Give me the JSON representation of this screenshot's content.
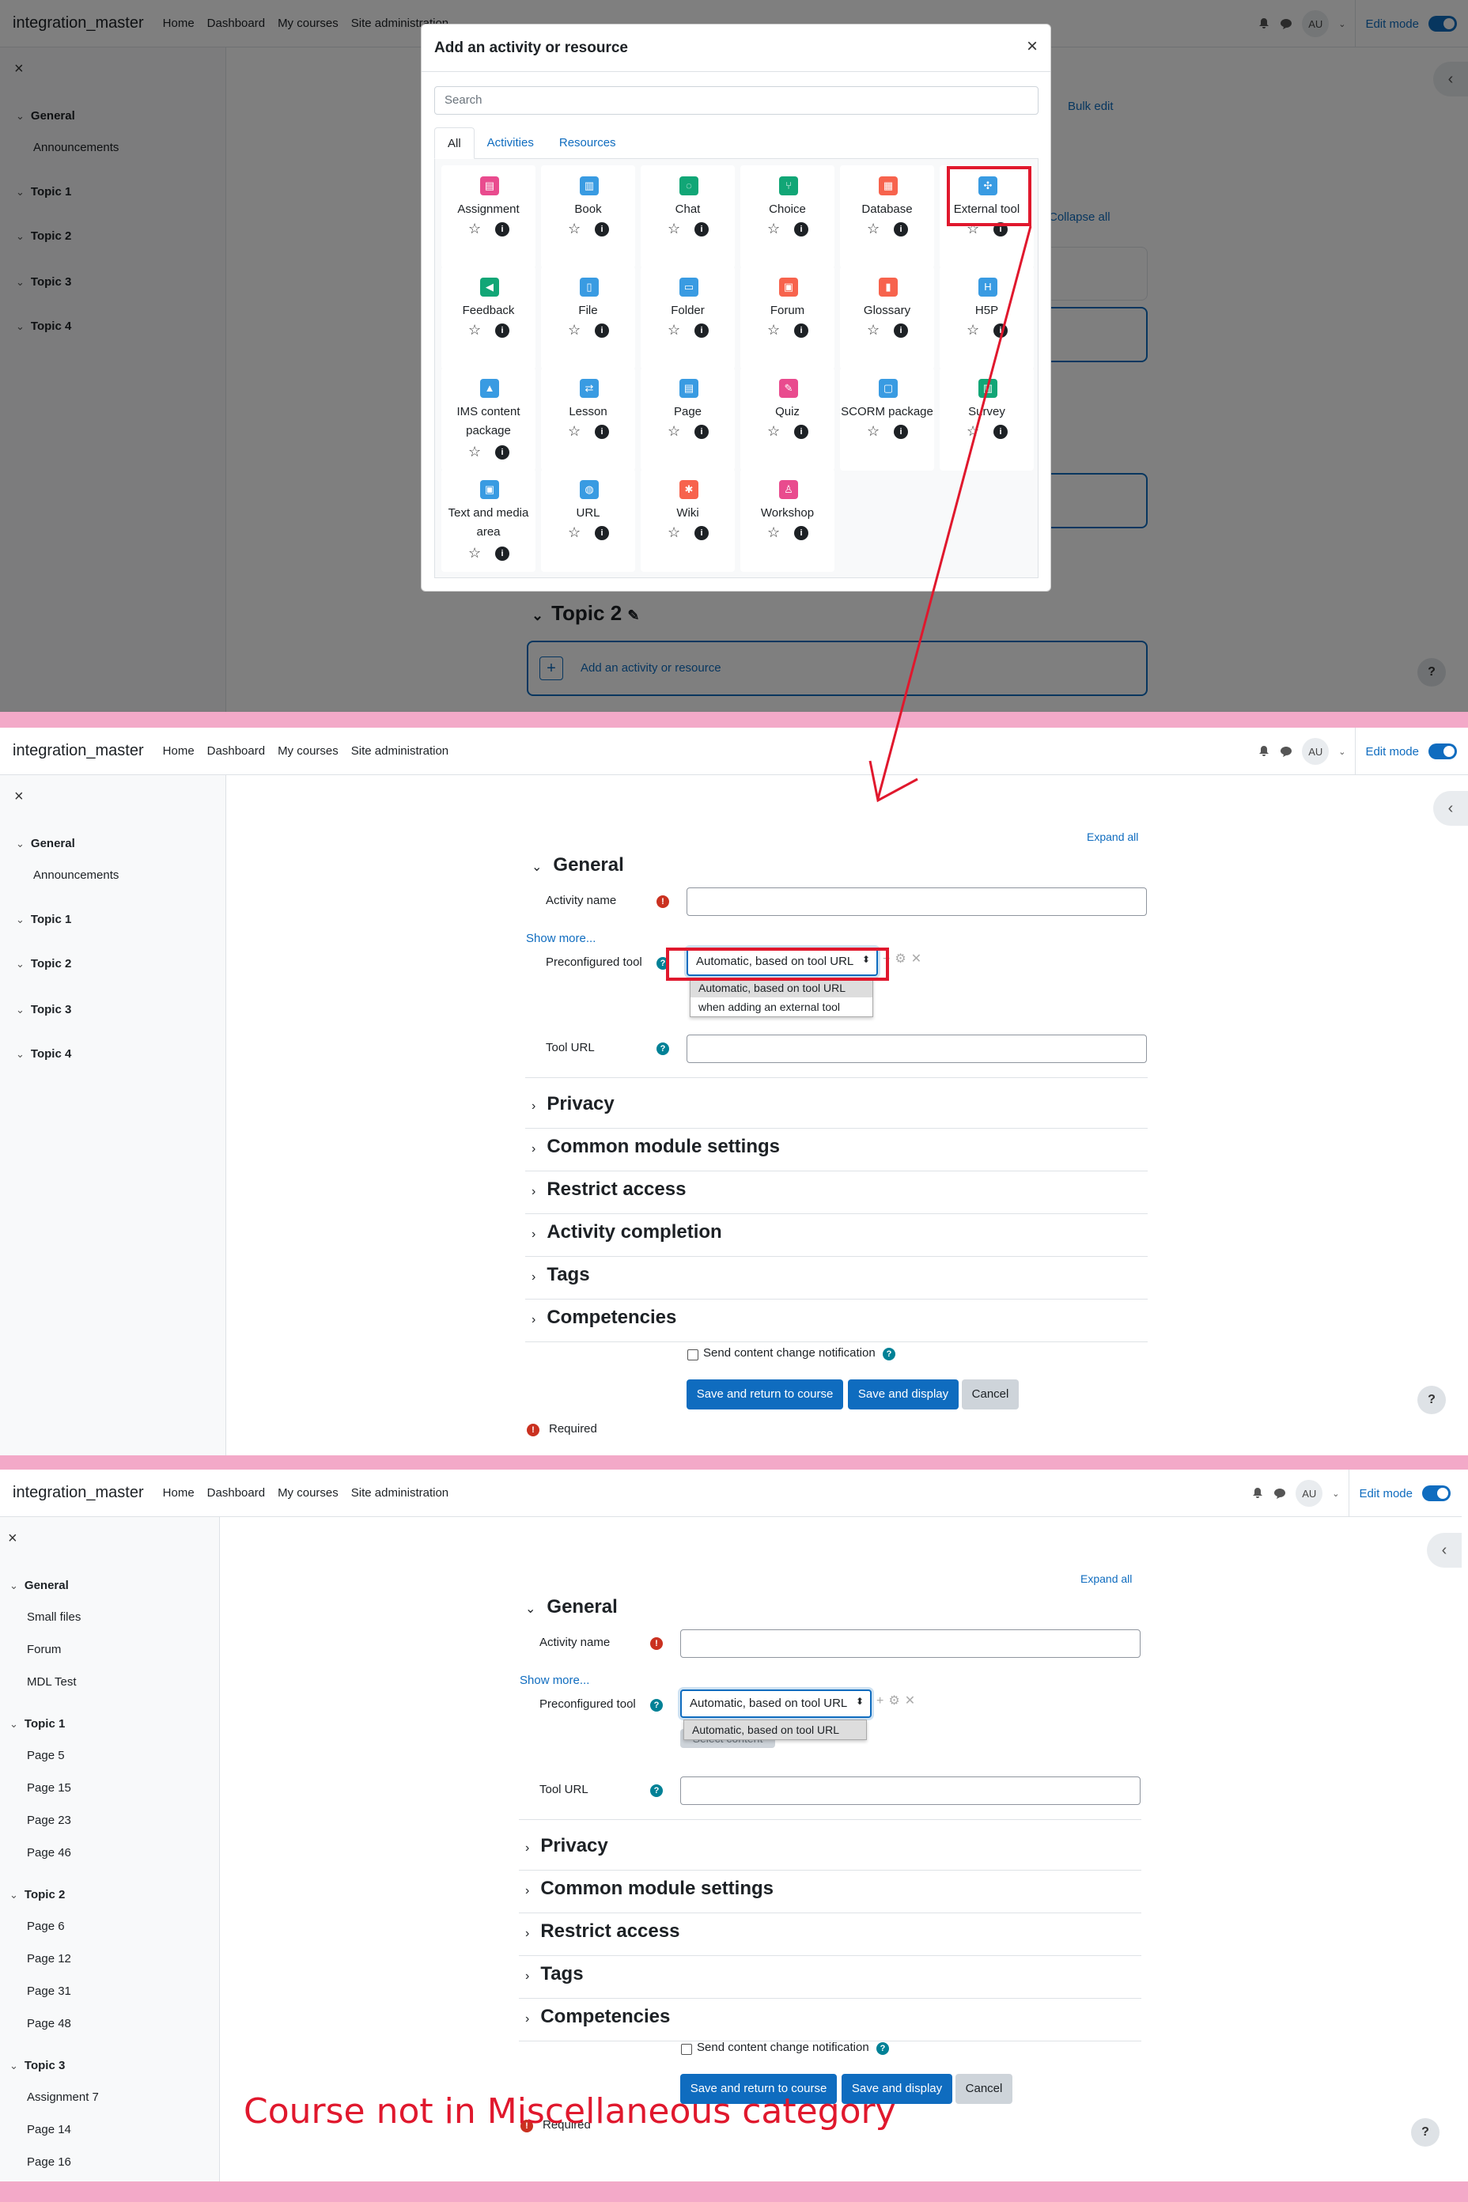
{
  "nav": {
    "brand": "integration_master",
    "links": [
      "Home",
      "Dashboard",
      "My courses",
      "Site administration"
    ],
    "avatar": "AU",
    "edit_mode": "Edit mode"
  },
  "panel1": {
    "drawer": {
      "close": "×",
      "sections": [
        {
          "title": "General",
          "items": [
            "Announcements"
          ]
        },
        {
          "title": "Topic 1",
          "items": []
        },
        {
          "title": "Topic 2",
          "items": []
        },
        {
          "title": "Topic 3",
          "items": []
        },
        {
          "title": "Topic 4",
          "items": []
        }
      ]
    },
    "background": {
      "bulk_edit": "Bulk edit",
      "collapse_all": "Collapse all",
      "topic2_heading": "Topic 2",
      "add_activity": "Add an activity or resource"
    },
    "modal": {
      "title": "Add an activity or resource",
      "close": "×",
      "search_placeholder": "Search",
      "tabs": [
        "All",
        "Activities",
        "Resources"
      ],
      "tiles": [
        {
          "name": "Assignment",
          "color": "#e94b8e",
          "glyph": "▤"
        },
        {
          "name": "Book",
          "color": "#399be2",
          "glyph": "▥"
        },
        {
          "name": "Chat",
          "color": "#11a676",
          "glyph": "◌"
        },
        {
          "name": "Choice",
          "color": "#11a676",
          "glyph": "⑂"
        },
        {
          "name": "Database",
          "color": "#f7634d",
          "glyph": "▦"
        },
        {
          "name": "External tool",
          "color": "#399be2",
          "glyph": "✣"
        },
        {
          "name": "Feedback",
          "color": "#11a676",
          "glyph": "◀"
        },
        {
          "name": "File",
          "color": "#399be2",
          "glyph": "▯"
        },
        {
          "name": "Folder",
          "color": "#399be2",
          "glyph": "▭"
        },
        {
          "name": "Forum",
          "color": "#f7634d",
          "glyph": "▣"
        },
        {
          "name": "Glossary",
          "color": "#f7634d",
          "glyph": "▮"
        },
        {
          "name": "H5P",
          "color": "#399be2",
          "glyph": "H"
        },
        {
          "name": "IMS content package",
          "color": "#399be2",
          "glyph": "▲"
        },
        {
          "name": "Lesson",
          "color": "#399be2",
          "glyph": "⇄"
        },
        {
          "name": "Page",
          "color": "#399be2",
          "glyph": "▤"
        },
        {
          "name": "Quiz",
          "color": "#e94b8e",
          "glyph": "✎"
        },
        {
          "name": "SCORM package",
          "color": "#399be2",
          "glyph": "▢"
        },
        {
          "name": "Survey",
          "color": "#11a676",
          "glyph": "▥"
        },
        {
          "name": "Text and media area",
          "color": "#399be2",
          "glyph": "▣"
        },
        {
          "name": "URL",
          "color": "#399be2",
          "glyph": "◍"
        },
        {
          "name": "Wiki",
          "color": "#f7634d",
          "glyph": "✱"
        },
        {
          "name": "Workshop",
          "color": "#e94b8e",
          "glyph": "♙"
        }
      ],
      "star": "☆",
      "info": "i"
    },
    "help": "?"
  },
  "form": {
    "expand_all": "Expand all",
    "general": "General",
    "activity_name": "Activity name",
    "show_more": "Show more...",
    "preconfigured_tool": "Preconfigured tool",
    "select_value": "Automatic, based on tool URL",
    "tool_url": "Tool URL",
    "notification": "Send content change notification",
    "save_return": "Save and return to course",
    "save_display": "Save and display",
    "cancel": "Cancel",
    "required": "Required",
    "help": "?"
  },
  "panel2": {
    "dropdown_options": [
      "Automatic, based on tool URL",
      "when adding an external tool"
    ],
    "sections": [
      "Privacy",
      "Common module settings",
      "Restrict access",
      "Activity completion",
      "Tags",
      "Competencies"
    ]
  },
  "panel3": {
    "dropdown_options": [
      "Automatic, based on tool URL"
    ],
    "select_content": "Select content",
    "sections": [
      "Privacy",
      "Common module settings",
      "Restrict access",
      "Tags",
      "Competencies"
    ],
    "drawer": {
      "sections": [
        {
          "title": "General",
          "items": [
            "Small files",
            "Forum",
            "MDL Test"
          ]
        },
        {
          "title": "Topic 1",
          "items": [
            "Page 5",
            "Page 15",
            "Page 23",
            "Page 46"
          ]
        },
        {
          "title": "Topic 2",
          "items": [
            "Page 6",
            "Page 12",
            "Page 31",
            "Page 48"
          ]
        },
        {
          "title": "Topic 3",
          "items": [
            "Assignment 7",
            "Page 14",
            "Page 16"
          ]
        }
      ]
    },
    "annotation": "Course not in Miscellaneous category"
  }
}
